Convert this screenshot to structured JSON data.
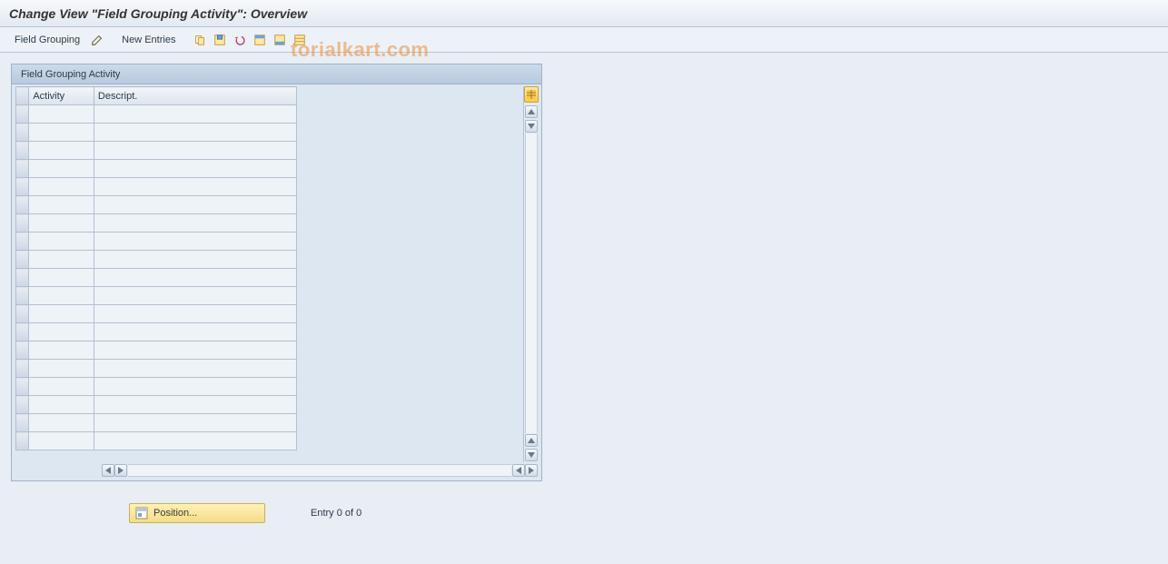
{
  "title": "Change View \"Field Grouping Activity\": Overview",
  "toolbar": {
    "field_grouping": "Field Grouping",
    "new_entries": "New Entries"
  },
  "panel": {
    "title": "Field Grouping Activity",
    "columns": {
      "activity": "Activity",
      "descript": "Descript."
    }
  },
  "footer": {
    "position": "Position...",
    "entry": "Entry 0 of 0"
  },
  "watermark": "torialkart.com",
  "row_count": 19
}
